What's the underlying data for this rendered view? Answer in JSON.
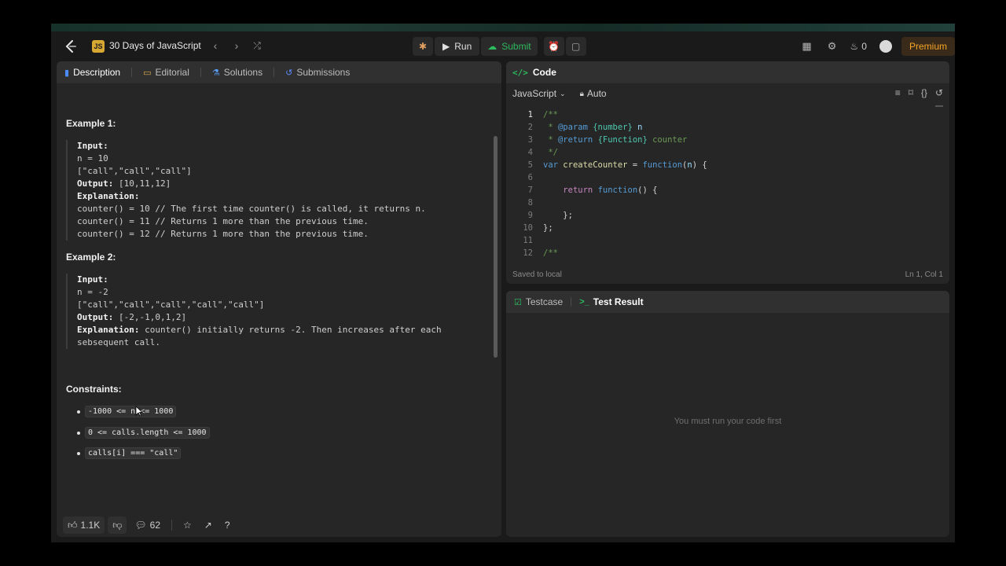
{
  "nav": {
    "list_title": "30 Days of JavaScript",
    "js_badge": "JS",
    "run_label": "Run",
    "submit_label": "Submit",
    "streak_count": "0",
    "premium_label": "Premium"
  },
  "left_tabs": [
    {
      "label": "Description",
      "icon": "description-icon"
    },
    {
      "label": "Editorial",
      "icon": "editorial-icon"
    },
    {
      "label": "Solutions",
      "icon": "flask-icon"
    },
    {
      "label": "Submissions",
      "icon": "history-icon"
    }
  ],
  "examples": [
    {
      "title": "Example 1:",
      "input_label": "Input:",
      "input_lines": [
        "n = 10",
        "[\"call\",\"call\",\"call\"]"
      ],
      "output_label": "Output:",
      "output_value": "[10,11,12]",
      "explanation_label": "Explanation:",
      "explanation_lines": [
        "counter() = 10 // The first time counter() is called, it returns n.",
        "counter() = 11 // Returns 1 more than the previous time.",
        "counter() = 12 // Returns 1 more than the previous time."
      ]
    },
    {
      "title": "Example 2:",
      "input_label": "Input:",
      "input_lines": [
        "n = -2",
        "[\"call\",\"call\",\"call\",\"call\",\"call\"]"
      ],
      "output_label": "Output:",
      "output_value": "[-2,-1,0,1,2]",
      "explanation_label": "Explanation:",
      "explanation_text": "counter() initially returns -2. Then increases after each",
      "explanation_cont": "sebsequent call."
    }
  ],
  "constraints": {
    "title": "Constraints:",
    "items": [
      "-1000 <= n <= 1000",
      "0 <= calls.length <= 1000",
      "calls[i] === \"call\""
    ]
  },
  "footer": {
    "likes": "1.1K",
    "comments": "62"
  },
  "code_panel": {
    "title": "Code",
    "language": "JavaScript",
    "mode": "Auto",
    "status_left": "Saved to local",
    "status_right": "Ln 1, Col 1",
    "line_numbers": [
      "1",
      "2",
      "3",
      "4",
      "5",
      "6",
      "7",
      "8",
      "9",
      "10",
      "11",
      "12"
    ]
  },
  "test_panel": {
    "tab_testcase": "Testcase",
    "tab_result": "Test Result",
    "empty_message": "You must run your code first"
  }
}
